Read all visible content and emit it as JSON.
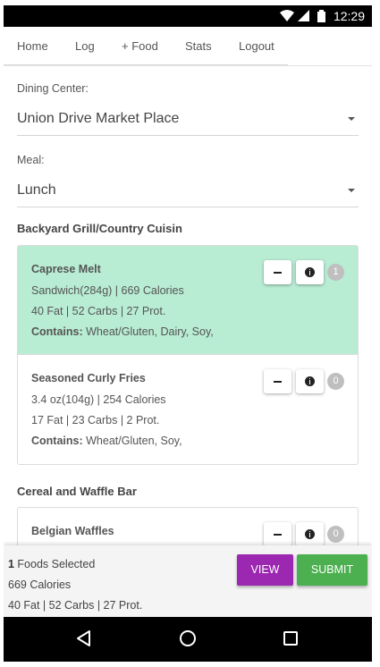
{
  "status_bar": {
    "time": "12:29",
    "icons": [
      "wifi-icon",
      "signal-icon",
      "battery-icon"
    ]
  },
  "nav": {
    "items": [
      {
        "label": "Home"
      },
      {
        "label": "Log"
      },
      {
        "label": "+ Food"
      },
      {
        "label": "Stats"
      },
      {
        "label": "Logout"
      }
    ]
  },
  "form": {
    "dining_center_label": "Dining Center:",
    "dining_center_value": "Union Drive Market Place",
    "meal_label": "Meal:",
    "meal_value": "Lunch"
  },
  "sections": [
    {
      "title": "Backyard Grill/Country Cuisin",
      "foods": [
        {
          "name": "Caprese Melt",
          "serving": "Sandwich(284g) | 669 Calories",
          "macros": "40 Fat | 52 Carbs | 27 Prot.",
          "contains_label": "Contains:",
          "contains": "Wheat/Gluten, Dairy, Soy,",
          "count": "1",
          "selected": true
        },
        {
          "name": "Seasoned Curly Fries",
          "serving": "3.4 oz(104g) | 254 Calories",
          "macros": "17 Fat | 23 Carbs | 2 Prot.",
          "contains_label": "Contains:",
          "contains": "Wheat/Gluten, Soy,",
          "count": "0",
          "selected": false
        }
      ]
    },
    {
      "title": "Cereal and Waffle Bar",
      "foods": [
        {
          "name": "Belgian Waffles",
          "count": "0",
          "selected": false
        }
      ]
    }
  ],
  "summary": {
    "foods_count": "1",
    "foods_selected_text": " Foods Selected",
    "calories": "669 Calories",
    "macros": "40 Fat | 52 Carbs | 27 Prot.",
    "view_label": "VIEW",
    "submit_label": "SUBMIT"
  },
  "colors": {
    "selected_card": "#b8ecd3",
    "view_button": "#9c27b0",
    "submit_button": "#4caf50",
    "badge": "#bfbfbf"
  }
}
